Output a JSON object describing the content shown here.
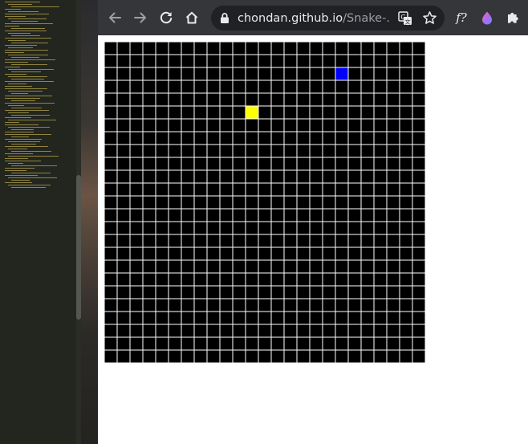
{
  "browser": {
    "url_host": "chondan.github.io",
    "url_path": "/Snake-...",
    "toolbar_icons": {
      "back": "arrow-left-icon",
      "forward": "arrow-right-icon",
      "reload": "reload-icon",
      "home": "home-icon",
      "lock": "lock-icon",
      "translate": "translate-icon",
      "bookmark": "star-icon",
      "extensions": "puzzle-icon"
    },
    "extensions": {
      "formula_label": "f?"
    }
  },
  "game": {
    "grid": {
      "cols": 25,
      "rows": 25
    },
    "colors": {
      "cell": "#000000",
      "gridline": "#ffffff",
      "snake": "#0000ff",
      "food": "#ffff00"
    },
    "snake": [
      {
        "col": 18,
        "row": 2
      }
    ],
    "food": {
      "col": 11,
      "row": 5
    }
  }
}
